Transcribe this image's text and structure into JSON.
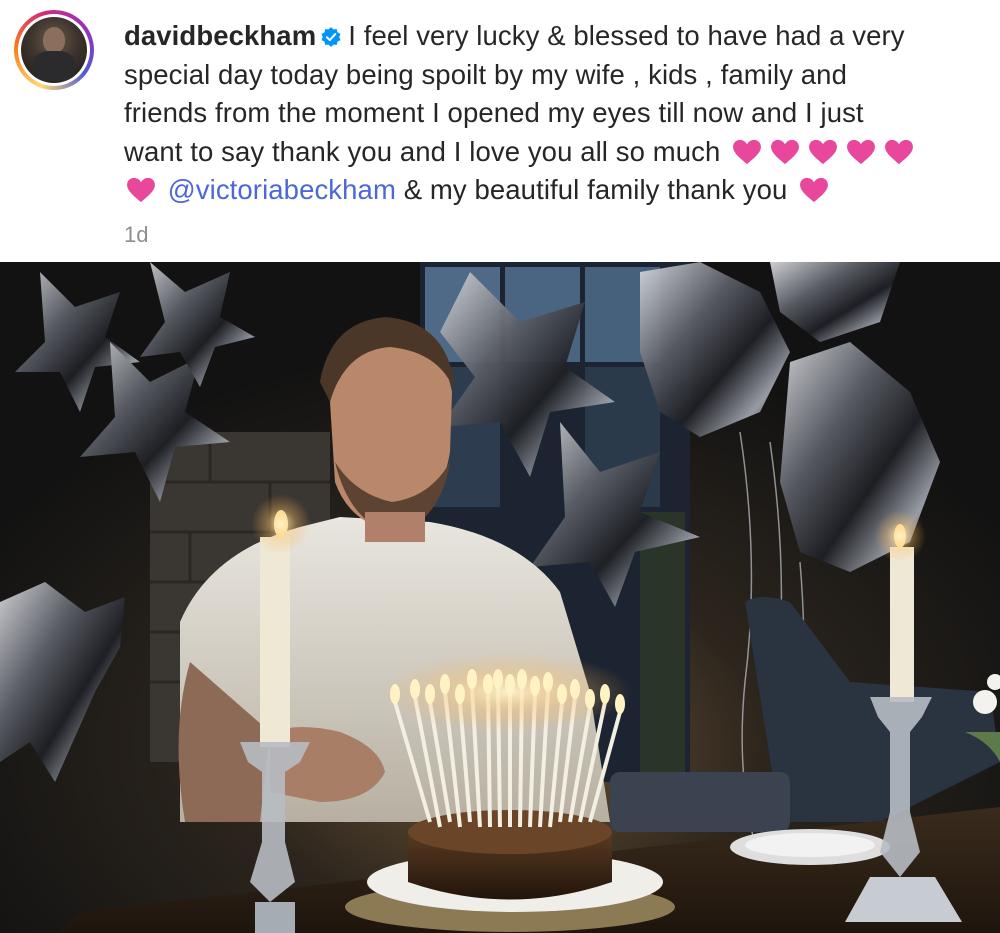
{
  "post": {
    "author": {
      "username": "davidbeckham",
      "verified": true,
      "avatar_icon": "profile-avatar"
    },
    "caption": {
      "line1": "I feel very lucky & blessed to have had a very",
      "line2": "special day today being spoilt by my wife , kids , family and",
      "line3": "friends from the moment I opened my eyes till now and I just",
      "line4": "want to say thank you and I love you all so much",
      "mention": "@victoriabeckham",
      "line5_tail": "& my beautiful family thank you",
      "emoji": "pink-heart"
    },
    "timestamp": "1d"
  },
  "colors": {
    "mention": "#4c68d7",
    "heart": "#e8479b",
    "verified": "#0095f6",
    "timestamp": "#8e8e8e"
  },
  "photo": {
    "description_icon": "birthday-cake-photo"
  }
}
